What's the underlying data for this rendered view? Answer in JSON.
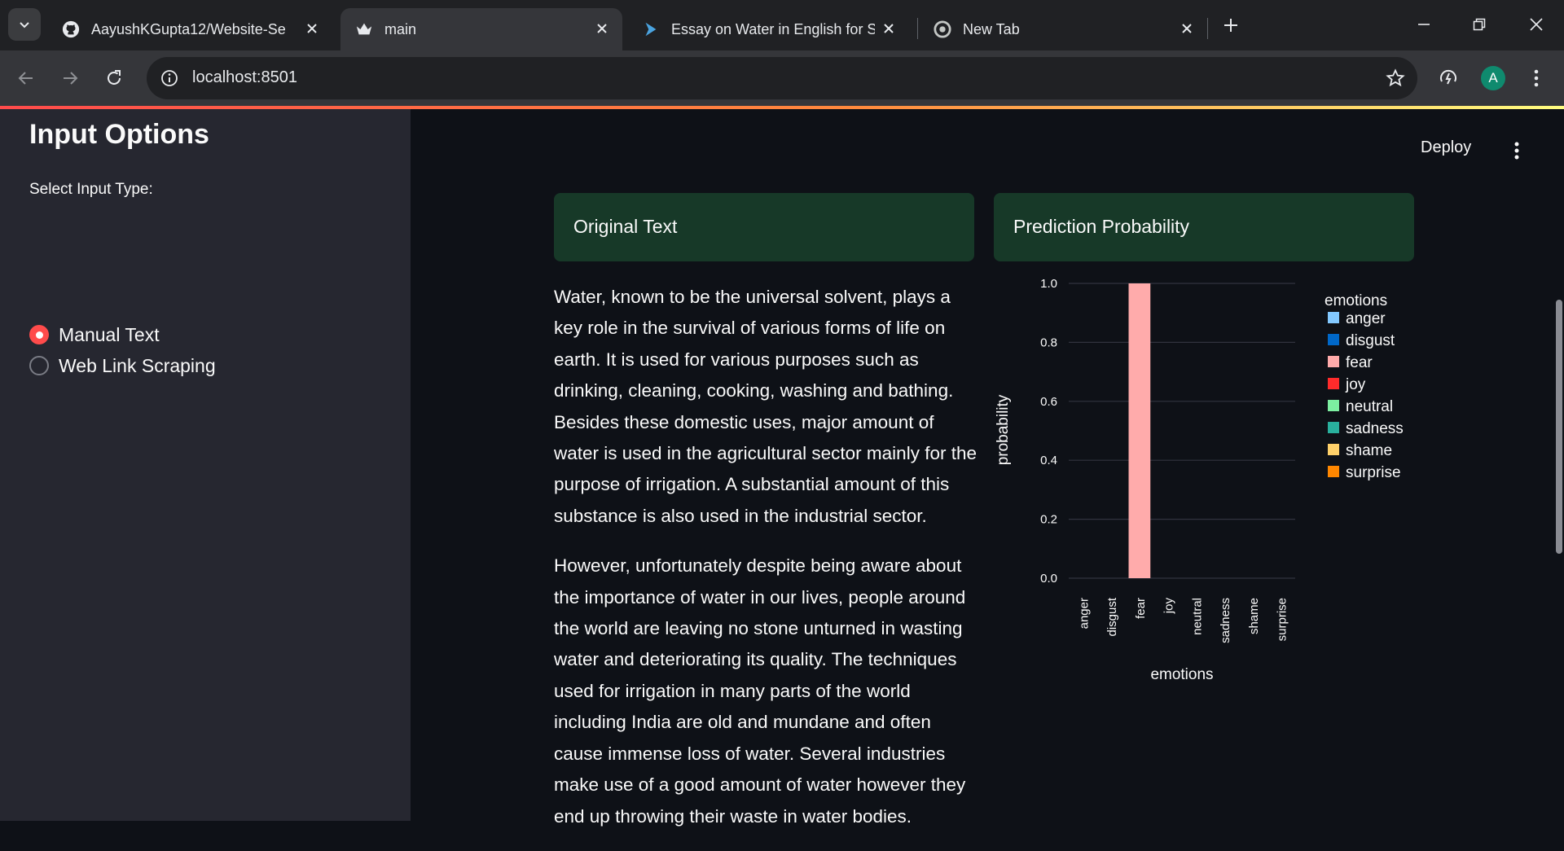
{
  "browser": {
    "tabs": [
      {
        "title": "AayushKGupta12/Website-Sent",
        "icon": "github-icon"
      },
      {
        "title": "main",
        "icon": "streamlit-icon"
      },
      {
        "title": "Essay on Water in English for St",
        "icon": "brand-arrow-icon"
      },
      {
        "title": "New Tab",
        "icon": "chrome-icon"
      }
    ],
    "address": "localhost:8501",
    "profile_initial": "A"
  },
  "app": {
    "deploy_label": "Deploy",
    "sidebar": {
      "title": "Input Options",
      "select_label": "Select Input Type:",
      "options": [
        {
          "label": "Manual Text",
          "selected": true
        },
        {
          "label": "Web Link Scraping",
          "selected": false
        }
      ]
    },
    "original_header": "Original Text",
    "prediction_header": "Prediction Probability",
    "paragraphs": [
      "Water, known to be the universal solvent, plays a key role in the survival of various forms of life on earth. It is used for various purposes such as drinking, cleaning, cooking, washing and bathing. Besides these domestic uses, major amount of water is used in the agricultural sector mainly for the purpose of irrigation. A substantial amount of this substance is also used in the industrial sector.",
      "However, unfortunately despite being aware about the importance of water in our lives, people around the world are leaving no stone unturned in wasting water and deteriorating its quality. The techniques used for irrigation in many parts of the world including India are old and mundane and often cause immense loss of water. Several industries make use of a good amount of water however they end up throwing their waste in water bodies."
    ]
  },
  "colors": {
    "accent": "#ff4b4b",
    "header_bg": "#173928"
  },
  "chart_data": {
    "type": "bar",
    "xlabel": "emotions",
    "ylabel": "probability",
    "legend_title": "emotions",
    "legend_placement": "right",
    "ylim": [
      0,
      1
    ],
    "yticks": [
      "0.0",
      "0.2",
      "0.4",
      "0.6",
      "0.8",
      "1.0"
    ],
    "grid": true,
    "categories": [
      "anger",
      "disgust",
      "fear",
      "joy",
      "neutral",
      "sadness",
      "shame",
      "surprise"
    ],
    "values": [
      0,
      0,
      1,
      0,
      0,
      0,
      0,
      0
    ],
    "category_colors": [
      "#83c9ff",
      "#0068c9",
      "#ffabab",
      "#ff2b2b",
      "#7defa1",
      "#29b09d",
      "#ffd16a",
      "#ff8700"
    ]
  }
}
